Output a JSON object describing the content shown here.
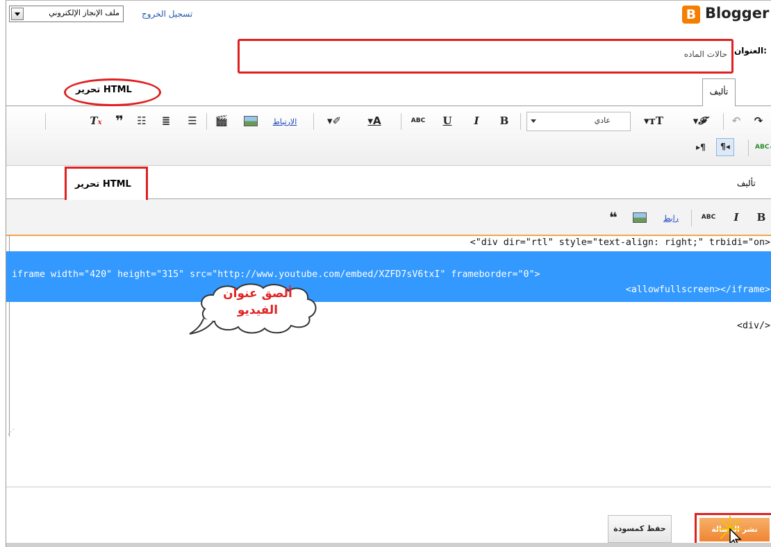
{
  "header": {
    "profile_select_value": "ملف الإنجاز الإلكتروني",
    "logout_label": "تسجيل الخروج",
    "logo_letter": "B",
    "logo_text": "Blogger",
    "brand_color": "#f57d00"
  },
  "post": {
    "title_label": "العنوان:",
    "title_value": "حالات الماده"
  },
  "tabs_top": {
    "compose_label": "تأليف",
    "html_label": "تحرير HTML"
  },
  "toolbar_top": {
    "font_select_value": "عادي",
    "link_label": "الارتباط",
    "icons": [
      "redo-icon",
      "undo-icon",
      "font-family-icon",
      "font-size-icon",
      "bold-icon",
      "italic-icon",
      "underline-icon",
      "strikethrough-icon",
      "text-color-icon",
      "highlight-icon",
      "link-icon",
      "image-icon",
      "video-icon",
      "align-icon",
      "numbered-list-icon",
      "bulleted-list-icon",
      "blockquote-icon",
      "remove-formatting-icon",
      "spellcheck-icon",
      "rtl-icon",
      "ltr-icon"
    ]
  },
  "tabs_inner": {
    "compose_label": "تأليف",
    "html_label": "تحرير HTML"
  },
  "toolbar_inner": {
    "link_label": "رابط",
    "icons": [
      "bold-icon",
      "italic-icon",
      "strikethrough-icon",
      "link-icon",
      "image-icon",
      "blockquote-icon"
    ]
  },
  "editor": {
    "line1": "<\"div dir=\"rtl\" style=\"text-align: right;\" trbidi=\"on>",
    "line2": "iframe width=\"420\" height=\"315\" src=\"http://www.youtube.com/embed/XZFD7sV6txI\" frameborder=\"0\">",
    "line3": "<allowfullscreen></iframe>",
    "line4": "<div/>"
  },
  "annotation": {
    "line1": "ألصق عنوان",
    "line2": "الفيديو",
    "color": "#e02424"
  },
  "actions": {
    "save_draft_label": "حفظ كمسودة",
    "publish_label": "نشر الرسالة",
    "highlight_color": "#e01f1f"
  }
}
